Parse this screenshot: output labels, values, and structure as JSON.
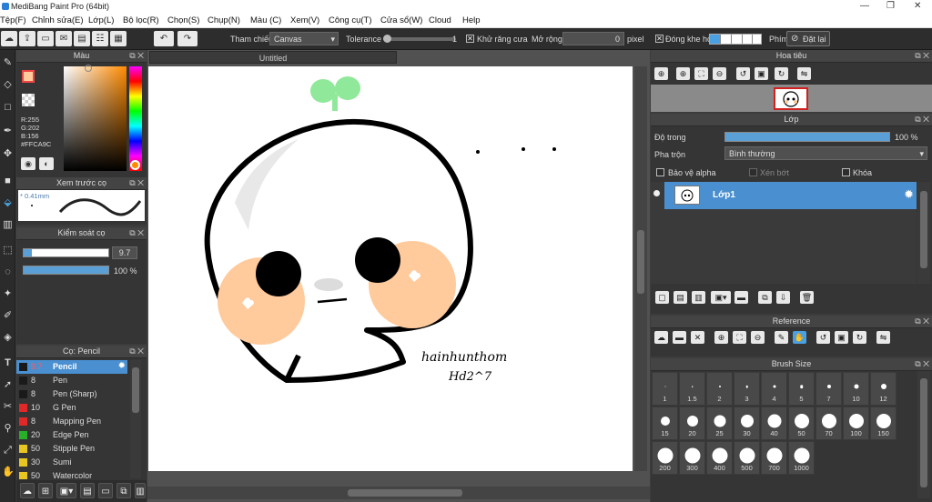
{
  "title": "MediBang Paint Pro (64bit)",
  "menu": [
    "Tệp(F)",
    "Chỉnh sửa(E)",
    "Lớp(L)",
    "Bộ lọc(R)",
    "Chọn(S)",
    "Chụp(N)",
    "Màu (C)",
    "Xem(V)",
    "Công cụ(T)",
    "Cửa sổ(W)",
    "Cloud",
    "Help"
  ],
  "toolbar": {
    "ref_label": "Tham chiếu",
    "ref_value": "Canvas",
    "tolerance_label": "Tolerance",
    "tolerance_value": "1",
    "antialias_label": "Khử răng cưa",
    "expand_label": "Mở rộng",
    "expand_value": "0",
    "expand_unit": "pixel",
    "gap_label": "Đóng khe hở",
    "key_label": "Phím",
    "reset_label": "Đặt lại"
  },
  "color_panel": {
    "title": "Màu",
    "r": "R:255",
    "g": "G:202",
    "b": "B:156",
    "hex": "#FFCA9C",
    "accent": "#ffca9c"
  },
  "brush_preview": {
    "title": "Xem trước cọ",
    "size": "* 0.41mm"
  },
  "brush_control": {
    "title": "Kiểm soát cọ",
    "size": "9.7",
    "opacity": "100 %",
    "size_fraction": 0.1,
    "opacity_fraction": 1.0
  },
  "brush_panel": {
    "title": "Cọ: Pencil",
    "items": [
      {
        "size": "9.7",
        "name": "Pencil",
        "color": "#1a1a1a"
      },
      {
        "size": "8",
        "name": "Pen",
        "color": "#1a1a1a"
      },
      {
        "size": "8",
        "name": "Pen (Sharp)",
        "color": "#1a1a1a"
      },
      {
        "size": "10",
        "name": "G Pen",
        "color": "#e02828"
      },
      {
        "size": "8",
        "name": "Mapping Pen",
        "color": "#e02828"
      },
      {
        "size": "20",
        "name": "Edge Pen",
        "color": "#28b028"
      },
      {
        "size": "50",
        "name": "Stipple Pen",
        "color": "#e8c820"
      },
      {
        "size": "30",
        "name": "Sumi",
        "color": "#e8c820"
      },
      {
        "size": "50",
        "name": "Watercolor",
        "color": "#e8c820"
      }
    ]
  },
  "document": {
    "tab": "Untitled",
    "signature_line1": "hainhunthom",
    "signature_line2": "Hd2^7"
  },
  "navigator": {
    "title": "Hoa tiêu"
  },
  "layer_panel": {
    "title": "Lớp",
    "opacity_label": "Độ trong",
    "opacity_value": "100 %",
    "opacity_fraction": 1.0,
    "blend_label": "Pha trộn",
    "blend_value": "Bình thường",
    "protect_alpha": "Bảo vệ alpha",
    "clipping": "Xén bớt",
    "lock": "Khóa",
    "layer_name": "Lớp1"
  },
  "reference_panel": {
    "title": "Reference"
  },
  "brush_size_panel": {
    "title": "Brush Size",
    "sizes": [
      "1",
      "1.5",
      "2",
      "3",
      "4",
      "5",
      "7",
      "10",
      "12",
      "15",
      "20",
      "25",
      "30",
      "40",
      "50",
      "70",
      "100",
      "150",
      "200",
      "300",
      "400",
      "500",
      "700",
      "1000"
    ]
  }
}
